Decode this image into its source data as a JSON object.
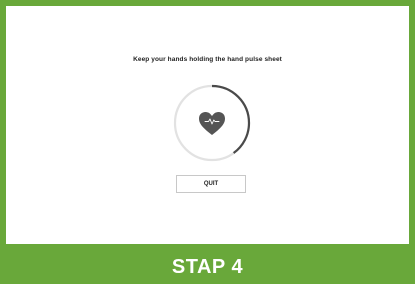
{
  "screen": {
    "instruction": "Keep your hands holding the hand pulse sheet",
    "progress": 0.4,
    "quit_label": "QUIT"
  },
  "footer": {
    "label": "STAP 4"
  },
  "colors": {
    "frame_green": "#69a83a",
    "heart_fill": "#555555",
    "ring_track": "#e2e2e2",
    "ring_progress": "#4a4a4a"
  },
  "icons": {
    "center": "heart-pulse-icon"
  }
}
